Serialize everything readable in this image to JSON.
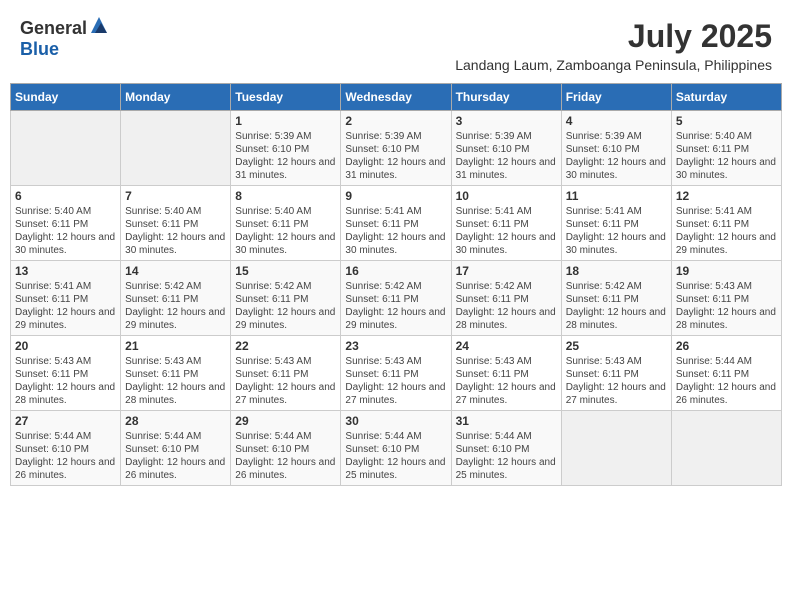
{
  "header": {
    "logo_general": "General",
    "logo_blue": "Blue",
    "month_year": "July 2025",
    "location": "Landang Laum, Zamboanga Peninsula, Philippines"
  },
  "calendar": {
    "days_of_week": [
      "Sunday",
      "Monday",
      "Tuesday",
      "Wednesday",
      "Thursday",
      "Friday",
      "Saturday"
    ],
    "weeks": [
      [
        {
          "day": "",
          "content": ""
        },
        {
          "day": "",
          "content": ""
        },
        {
          "day": "1",
          "content": "Sunrise: 5:39 AM\nSunset: 6:10 PM\nDaylight: 12 hours\nand 31 minutes."
        },
        {
          "day": "2",
          "content": "Sunrise: 5:39 AM\nSunset: 6:10 PM\nDaylight: 12 hours\nand 31 minutes."
        },
        {
          "day": "3",
          "content": "Sunrise: 5:39 AM\nSunset: 6:10 PM\nDaylight: 12 hours\nand 31 minutes."
        },
        {
          "day": "4",
          "content": "Sunrise: 5:39 AM\nSunset: 6:10 PM\nDaylight: 12 hours\nand 30 minutes."
        },
        {
          "day": "5",
          "content": "Sunrise: 5:40 AM\nSunset: 6:11 PM\nDaylight: 12 hours\nand 30 minutes."
        }
      ],
      [
        {
          "day": "6",
          "content": "Sunrise: 5:40 AM\nSunset: 6:11 PM\nDaylight: 12 hours\nand 30 minutes."
        },
        {
          "day": "7",
          "content": "Sunrise: 5:40 AM\nSunset: 6:11 PM\nDaylight: 12 hours\nand 30 minutes."
        },
        {
          "day": "8",
          "content": "Sunrise: 5:40 AM\nSunset: 6:11 PM\nDaylight: 12 hours\nand 30 minutes."
        },
        {
          "day": "9",
          "content": "Sunrise: 5:41 AM\nSunset: 6:11 PM\nDaylight: 12 hours\nand 30 minutes."
        },
        {
          "day": "10",
          "content": "Sunrise: 5:41 AM\nSunset: 6:11 PM\nDaylight: 12 hours\nand 30 minutes."
        },
        {
          "day": "11",
          "content": "Sunrise: 5:41 AM\nSunset: 6:11 PM\nDaylight: 12 hours\nand 30 minutes."
        },
        {
          "day": "12",
          "content": "Sunrise: 5:41 AM\nSunset: 6:11 PM\nDaylight: 12 hours\nand 29 minutes."
        }
      ],
      [
        {
          "day": "13",
          "content": "Sunrise: 5:41 AM\nSunset: 6:11 PM\nDaylight: 12 hours\nand 29 minutes."
        },
        {
          "day": "14",
          "content": "Sunrise: 5:42 AM\nSunset: 6:11 PM\nDaylight: 12 hours\nand 29 minutes."
        },
        {
          "day": "15",
          "content": "Sunrise: 5:42 AM\nSunset: 6:11 PM\nDaylight: 12 hours\nand 29 minutes."
        },
        {
          "day": "16",
          "content": "Sunrise: 5:42 AM\nSunset: 6:11 PM\nDaylight: 12 hours\nand 29 minutes."
        },
        {
          "day": "17",
          "content": "Sunrise: 5:42 AM\nSunset: 6:11 PM\nDaylight: 12 hours\nand 28 minutes."
        },
        {
          "day": "18",
          "content": "Sunrise: 5:42 AM\nSunset: 6:11 PM\nDaylight: 12 hours\nand 28 minutes."
        },
        {
          "day": "19",
          "content": "Sunrise: 5:43 AM\nSunset: 6:11 PM\nDaylight: 12 hours\nand 28 minutes."
        }
      ],
      [
        {
          "day": "20",
          "content": "Sunrise: 5:43 AM\nSunset: 6:11 PM\nDaylight: 12 hours\nand 28 minutes."
        },
        {
          "day": "21",
          "content": "Sunrise: 5:43 AM\nSunset: 6:11 PM\nDaylight: 12 hours\nand 28 minutes."
        },
        {
          "day": "22",
          "content": "Sunrise: 5:43 AM\nSunset: 6:11 PM\nDaylight: 12 hours\nand 27 minutes."
        },
        {
          "day": "23",
          "content": "Sunrise: 5:43 AM\nSunset: 6:11 PM\nDaylight: 12 hours\nand 27 minutes."
        },
        {
          "day": "24",
          "content": "Sunrise: 5:43 AM\nSunset: 6:11 PM\nDaylight: 12 hours\nand 27 minutes."
        },
        {
          "day": "25",
          "content": "Sunrise: 5:43 AM\nSunset: 6:11 PM\nDaylight: 12 hours\nand 27 minutes."
        },
        {
          "day": "26",
          "content": "Sunrise: 5:44 AM\nSunset: 6:11 PM\nDaylight: 12 hours\nand 26 minutes."
        }
      ],
      [
        {
          "day": "27",
          "content": "Sunrise: 5:44 AM\nSunset: 6:10 PM\nDaylight: 12 hours\nand 26 minutes."
        },
        {
          "day": "28",
          "content": "Sunrise: 5:44 AM\nSunset: 6:10 PM\nDaylight: 12 hours\nand 26 minutes."
        },
        {
          "day": "29",
          "content": "Sunrise: 5:44 AM\nSunset: 6:10 PM\nDaylight: 12 hours\nand 26 minutes."
        },
        {
          "day": "30",
          "content": "Sunrise: 5:44 AM\nSunset: 6:10 PM\nDaylight: 12 hours\nand 25 minutes."
        },
        {
          "day": "31",
          "content": "Sunrise: 5:44 AM\nSunset: 6:10 PM\nDaylight: 12 hours\nand 25 minutes."
        },
        {
          "day": "",
          "content": ""
        },
        {
          "day": "",
          "content": ""
        }
      ]
    ]
  }
}
